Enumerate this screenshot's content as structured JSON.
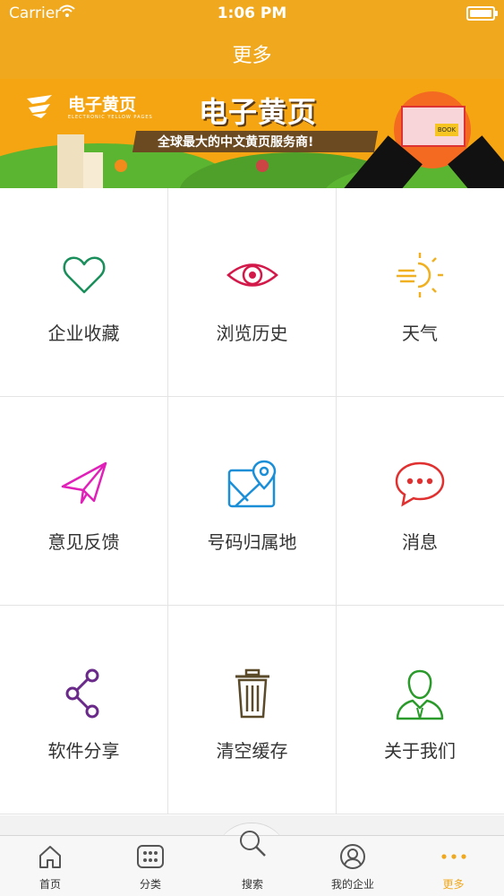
{
  "status_bar": {
    "carrier": "Carrier",
    "time": "1:06 PM"
  },
  "nav": {
    "title": "更多"
  },
  "banner": {
    "logo_text": "电子黄页",
    "logo_sub": "ELECTRONIC YELLOW PAGES",
    "headline": "电子黄页",
    "slogan": "全球最大的中文黄页服务商!",
    "book_label": "BOOK"
  },
  "grid": [
    {
      "label": "企业收藏",
      "icon": "heart-icon",
      "color": "#1a8f5c"
    },
    {
      "label": "浏览历史",
      "icon": "eye-icon",
      "color": "#d3194a"
    },
    {
      "label": "天气",
      "icon": "weather-sun-icon",
      "color": "#f0b020"
    },
    {
      "label": "意见反馈",
      "icon": "paper-plane-icon",
      "color": "#e020b8"
    },
    {
      "label": "号码归属地",
      "icon": "map-pin-icon",
      "color": "#1a8fd8"
    },
    {
      "label": "消息",
      "icon": "chat-bubble-icon",
      "color": "#e03030"
    },
    {
      "label": "软件分享",
      "icon": "share-icon",
      "color": "#6a2a8a"
    },
    {
      "label": "清空缓存",
      "icon": "trash-icon",
      "color": "#5a4a2a"
    },
    {
      "label": "关于我们",
      "icon": "user-icon",
      "color": "#2a9a2a"
    }
  ],
  "tabbar": {
    "active_color": "#f0a81e",
    "items": [
      {
        "label": "首页",
        "icon": "home-icon"
      },
      {
        "label": "分类",
        "icon": "grid-dots-icon"
      },
      {
        "label": "搜索",
        "icon": "search-icon"
      },
      {
        "label": "我的企业",
        "icon": "user-circle-icon"
      },
      {
        "label": "更多",
        "icon": "more-dots-icon"
      }
    ]
  }
}
